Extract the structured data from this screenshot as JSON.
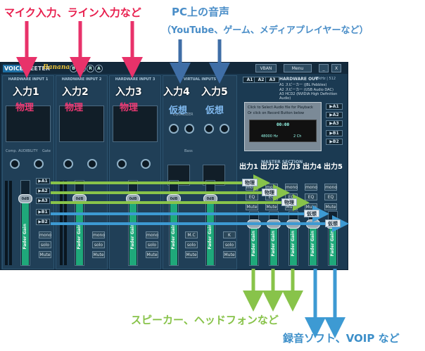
{
  "annotations": {
    "header_mic": "マイク入力、ライン入力など",
    "header_pc": "PC上の音声",
    "header_pc_sub": "（YouTube、ゲーム、メディアプレイヤーなど）",
    "caption_speaker": "スピーカー、ヘッドフォンなど",
    "caption_record": "録音ソフト、VOIP など",
    "input_labels": [
      "入力1",
      "入力2",
      "入力3",
      "入力4",
      "入力5"
    ],
    "input_kinds": [
      "物理",
      "物理",
      "物理",
      "仮想",
      "仮想"
    ],
    "output_labels": [
      "出力1",
      "出力2",
      "出力3",
      "出力4",
      "出力5"
    ],
    "bus_tags": [
      "物理",
      "物理",
      "物理",
      "仮想",
      "仮想"
    ],
    "colors": {
      "red": "#e81e4d",
      "blue": "#4a8ec8",
      "green": "#88c34a",
      "arrow_blue": "#3d8fc9"
    }
  },
  "app": {
    "logo_voice": "VOICE",
    "logo_meeter": "MEETER",
    "banana": "Banana",
    "letters": [
      "B",
      "L",
      "R",
      "A"
    ],
    "vban": "VBAN",
    "menu": "Menu",
    "minimize": "_",
    "close": "X",
    "strips": [
      {
        "title": "HARDWARE INPUT 1"
      },
      {
        "title": "HARDWARE INPUT 2"
      },
      {
        "title": "HARDWARE INPUT 3"
      },
      {
        "title": "VIRTUAL INPUTS"
      },
      {
        "title": ""
      }
    ],
    "hw_out_title": "HARDWARE OUT",
    "hw_out_rate": "48kHz | 512",
    "hw_out_devices": [
      "A1  スピーカー (JBL Pebbles)",
      "A2  スピーカー (USB Audio DAC)",
      "A3  HCD2 (NVIDIA High Definition Audio)"
    ],
    "out_selectors": [
      "A1",
      "A2",
      "A3"
    ],
    "player_title": "Click to Select Audio file for Playback",
    "player_sub": "Or click on Record Button below",
    "player_time": "00:00",
    "player_rate": "48000 Hz",
    "player_ch": "2 Ch",
    "player_a_buttons": [
      "▶A1",
      "▶A2",
      "▶A3"
    ],
    "player_b_buttons": [
      "▶B1",
      "▶B2"
    ],
    "master_section": "MASTER SECTION",
    "comp_label": "Comp.",
    "audibility_label": "AUDIBILITY",
    "gate_label": "Gate",
    "equalizer_label": "EQUALIZER",
    "bass_label": "Bass",
    "bus_buttons": [
      "▶A1",
      "▶A2",
      "▶A3",
      "▶B1",
      "▶B2"
    ],
    "mono": "mono",
    "solo": "solo",
    "mute": "Mute",
    "mc": "M.C",
    "k": "K",
    "eq": "EQ",
    "fader_value": "0dB",
    "fader_gain": "Fader Gain",
    "pan_label": "Pan",
    "position_label": "POSITION"
  }
}
